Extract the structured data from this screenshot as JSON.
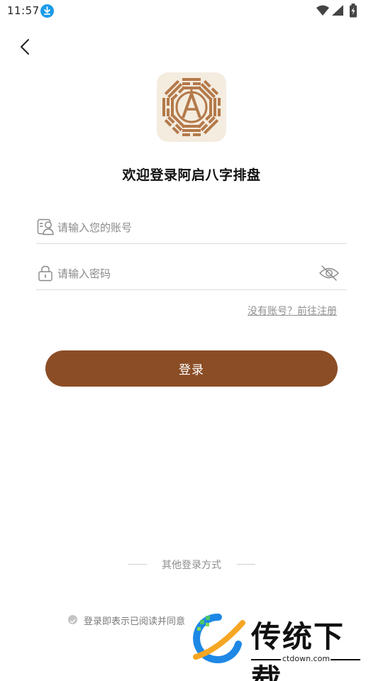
{
  "status_bar": {
    "time": "11:57"
  },
  "login": {
    "title": "欢迎登录阿启八字排盘",
    "account_placeholder": "请输入您的账号",
    "password_placeholder": "请输入密码",
    "register_link": "没有账号？前往注册",
    "login_button": "登录",
    "other_login": "其他登录方式",
    "agreement_text": "登录即表示已阅读并同意"
  },
  "watermark": {
    "brand": "传统下载",
    "domain": "ctdown.com"
  },
  "colors": {
    "primary": "#8b4d25",
    "logo_bg": "#f4ecdf",
    "logo_fg": "#b4794a"
  }
}
